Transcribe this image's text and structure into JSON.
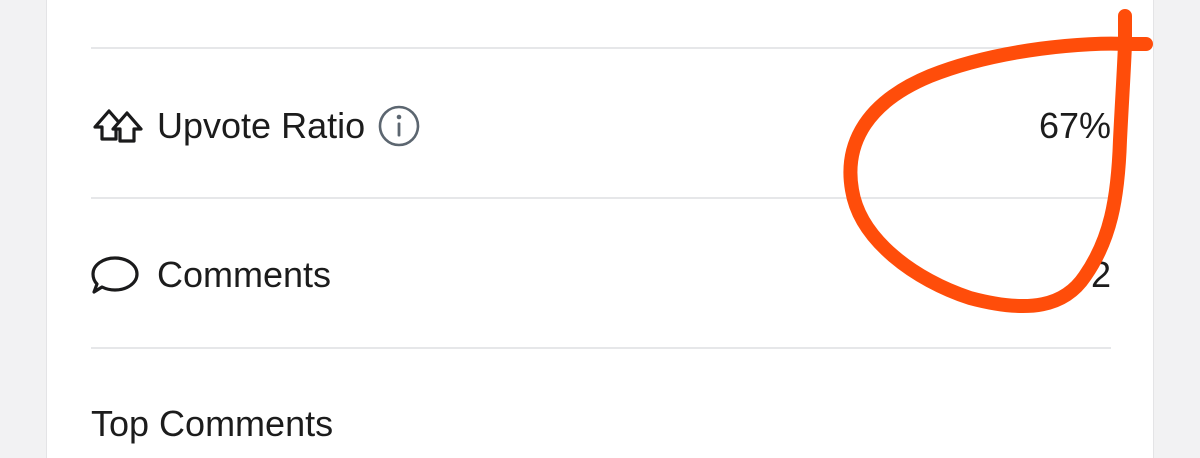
{
  "stats": {
    "upvote_ratio": {
      "label": "Upvote Ratio",
      "value": "67%",
      "icon": "upvote-arrows-icon",
      "info_icon": "info-icon"
    },
    "comments": {
      "label": "Comments",
      "value": "2",
      "icon": "comment-bubble-icon"
    }
  },
  "top_comments": {
    "title": "Top Comments"
  },
  "annotation": {
    "color": "#ff4d0a",
    "shape": "hand-drawn-circle"
  }
}
